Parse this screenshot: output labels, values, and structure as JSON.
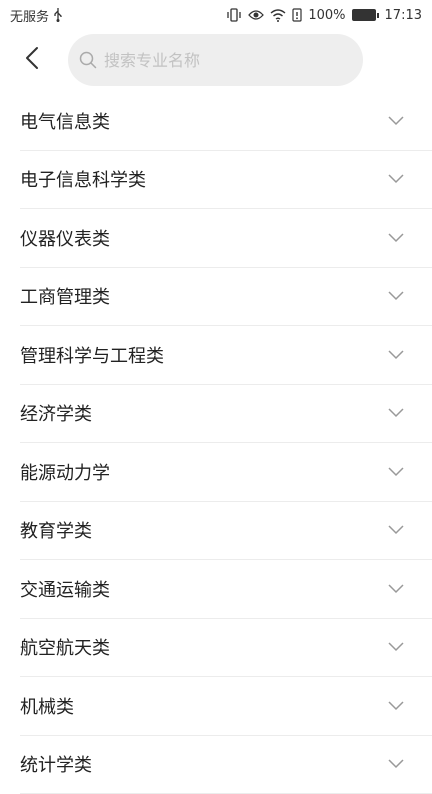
{
  "status_bar": {
    "carrier": "无服务",
    "battery_percent": "100%",
    "time": "17:13"
  },
  "search": {
    "placeholder": "搜索专业名称",
    "value": ""
  },
  "categories": [
    {
      "label": "电气信息类"
    },
    {
      "label": "电子信息科学类"
    },
    {
      "label": "仪器仪表类"
    },
    {
      "label": "工商管理类"
    },
    {
      "label": "管理科学与工程类"
    },
    {
      "label": "经济学类"
    },
    {
      "label": "能源动力学"
    },
    {
      "label": "教育学类"
    },
    {
      "label": "交通运输类"
    },
    {
      "label": "航空航天类"
    },
    {
      "label": "机械类"
    },
    {
      "label": "统计学类"
    }
  ],
  "icons": {
    "back": "chevron-left-icon",
    "search": "search-icon",
    "expand": "chevron-down-icon"
  },
  "colors": {
    "search_bg": "#eeeeee",
    "divider": "#ececec",
    "text": "#222222",
    "placeholder": "#c2c2c2"
  }
}
